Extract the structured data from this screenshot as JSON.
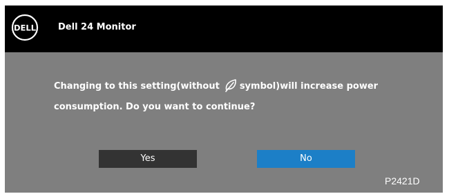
{
  "header": {
    "logo_text": "DELL",
    "title": "Dell 24 Monitor"
  },
  "dialog": {
    "message_line1_before_icon": "Changing to this setting(without",
    "message_icon": "energy-saving-leaf-icon",
    "message_line1_after_icon": "symbol)will increase power",
    "message_line2": "consumption. Do you want to continue?"
  },
  "buttons": {
    "yes_label": "Yes",
    "no_label": "No"
  },
  "footer": {
    "model": "P2421D"
  },
  "colors": {
    "panel": "#7f7f7f",
    "titlebar": "#000000",
    "yes_button": "#333333",
    "no_button_selected": "#1c7fc7",
    "text": "#ffffff"
  }
}
